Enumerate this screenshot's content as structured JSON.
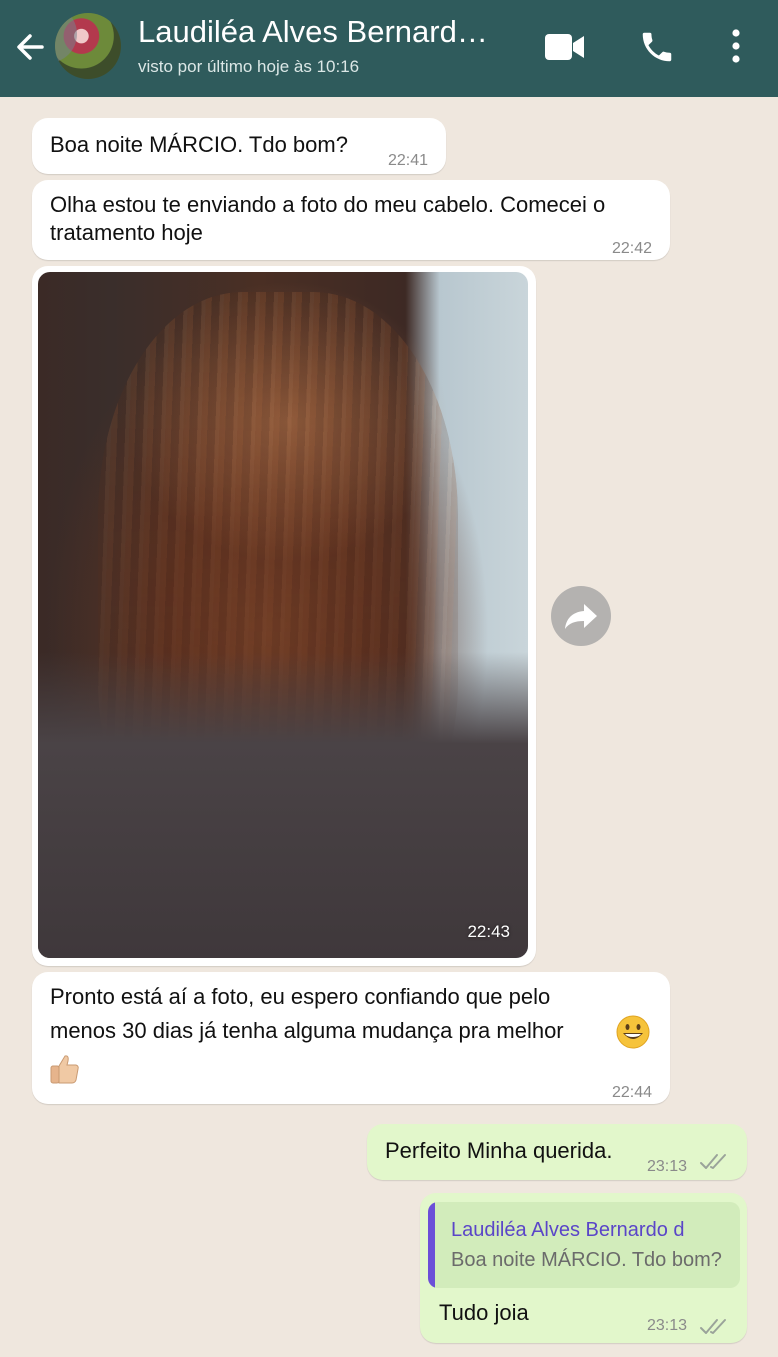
{
  "header": {
    "contact_name": "Laudiléa Alves Bernard…",
    "last_seen": "visto por último hoje às 10:16",
    "icons": [
      "back-arrow-icon",
      "video-call-icon",
      "phone-icon",
      "more-options-icon"
    ]
  },
  "messages": [
    {
      "direction": "in",
      "text": "Boa noite MÁRCIO. Tdo bom?",
      "time": "22:41"
    },
    {
      "direction": "in",
      "lines": [
        "Olha estou te enviando a foto do meu cabelo. Comecei o",
        "tratamento hoje"
      ],
      "time": "22:42"
    },
    {
      "direction": "in",
      "type": "image",
      "time": "22:43"
    },
    {
      "direction": "in",
      "lines": [
        "Pronto está aí a foto, eu espero confiando que pelo",
        "menos  30 dias já tenha alguma mudança pra melhor"
      ],
      "emoji": [
        "grinning-face-emoji",
        "thumbs-up-emoji"
      ],
      "time": "22:44"
    },
    {
      "direction": "out",
      "text": "Perfeito Minha querida.",
      "time": "23:13",
      "status": "read"
    },
    {
      "direction": "out",
      "quote_name": "Laudiléa Alves Bernardo d",
      "quote_text": "Boa noite MÁRCIO. Tdo bom?",
      "text": "Tudo joia",
      "time": "23:13",
      "status": "read"
    }
  ],
  "colors": {
    "header_bg": "#2f5b5c",
    "chat_bg": "#efe7de",
    "incoming_bubble": "#ffffff",
    "outgoing_bubble": "#e2f7cb",
    "quote_accent": "#6b4fd8"
  }
}
